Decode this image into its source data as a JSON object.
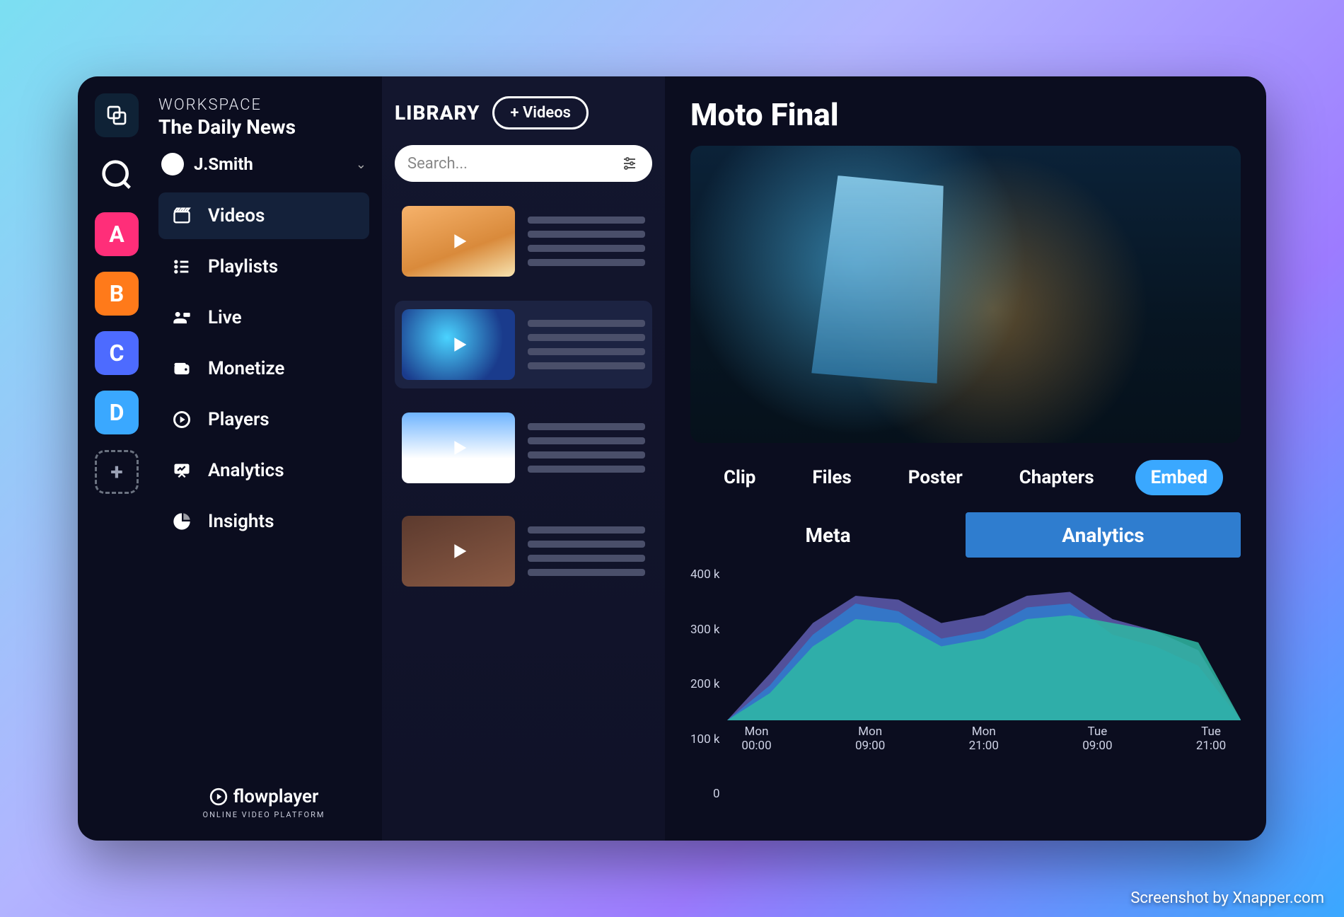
{
  "rail": {
    "items": [
      {
        "name": "stack-icon",
        "label": ""
      },
      {
        "name": "search-icon",
        "label": ""
      },
      {
        "name": "workspace-a",
        "label": "A"
      },
      {
        "name": "workspace-b",
        "label": "B"
      },
      {
        "name": "workspace-c",
        "label": "C"
      },
      {
        "name": "workspace-d",
        "label": "D"
      },
      {
        "name": "add-workspace",
        "label": "+"
      }
    ]
  },
  "workspace": {
    "label": "WORKSPACE",
    "name": "The Daily News",
    "user": "J.Smith"
  },
  "sidebar": {
    "items": [
      {
        "label": "Videos",
        "icon": "clapper-icon",
        "active": true
      },
      {
        "label": "Playlists",
        "icon": "list-icon"
      },
      {
        "label": "Live",
        "icon": "live-icon"
      },
      {
        "label": "Monetize",
        "icon": "wallet-icon"
      },
      {
        "label": "Players",
        "icon": "play-circle-icon"
      },
      {
        "label": "Analytics",
        "icon": "presentation-icon"
      },
      {
        "label": "Insights",
        "icon": "pie-icon"
      }
    ]
  },
  "brand": {
    "name": "flowplayer",
    "tagline": "ONLINE VIDEO PLATFORM"
  },
  "library": {
    "title": "LIBRARY",
    "add_button": "+ Videos",
    "search_placeholder": "Search...",
    "selected_index": 1
  },
  "main": {
    "title": "Moto Final",
    "tabs": [
      "Clip",
      "Files",
      "Poster",
      "Chapters",
      "Embed"
    ],
    "active_tab_index": 4,
    "subtabs": [
      "Meta",
      "Analytics"
    ],
    "active_subtab_index": 1
  },
  "chart_data": {
    "type": "area",
    "ylabel": "",
    "ylim": [
      0,
      400000
    ],
    "y_ticks": [
      "400 k",
      "300 k",
      "200 k",
      "100 k",
      "0"
    ],
    "x_ticks": [
      "Mon\n00:00",
      "Mon\n09:00",
      "Mon\n21:00",
      "Tue\n09:00",
      "Tue\n21:00"
    ],
    "x": [
      0,
      1,
      2,
      3,
      4,
      5,
      6,
      7,
      8,
      9,
      10,
      11,
      12
    ],
    "series": [
      {
        "name": "series-a",
        "color": "#5f5db0",
        "values": [
          0,
          120000,
          250000,
          320000,
          310000,
          250000,
          270000,
          320000,
          330000,
          260000,
          230000,
          180000,
          0
        ]
      },
      {
        "name": "series-b",
        "color": "#2f7dcf",
        "values": [
          0,
          90000,
          220000,
          300000,
          280000,
          210000,
          230000,
          290000,
          300000,
          220000,
          190000,
          140000,
          0
        ]
      },
      {
        "name": "series-c",
        "color": "#2fb9a3",
        "values": [
          0,
          70000,
          190000,
          260000,
          250000,
          190000,
          210000,
          260000,
          270000,
          250000,
          230000,
          200000,
          0
        ]
      }
    ]
  },
  "watermark": "Screenshot by Xnapper.com"
}
